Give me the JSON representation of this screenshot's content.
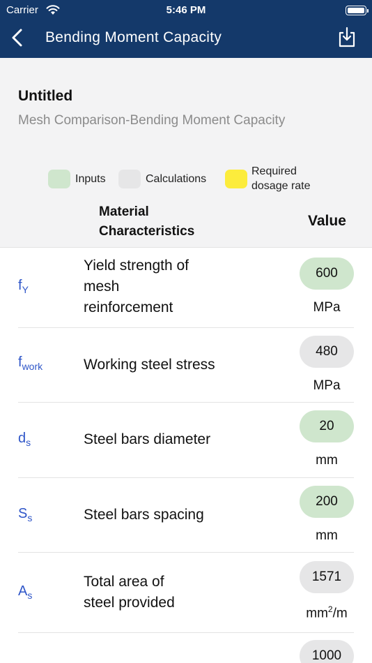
{
  "status_bar": {
    "carrier": "Carrier",
    "time": "5:46 PM"
  },
  "nav": {
    "title": "Bending Moment Capacity",
    "back_icon": "chevron-left-icon",
    "download_icon": "download-icon"
  },
  "document": {
    "title": "Untitled",
    "subtitle": "Mesh Comparison-Bending Moment Capacity"
  },
  "legend": {
    "inputs": "Inputs",
    "calculations": "Calculations",
    "required_line1": "Required",
    "required_line2": "dosage rate",
    "colors": {
      "inputs": "#cfe6cd",
      "calculations": "#e6e6e7",
      "required": "#fcec3c"
    }
  },
  "table": {
    "header_material_line1": "Material",
    "header_material_line2": "Characteristics",
    "header_value": "Value",
    "rows": [
      {
        "sym": "f",
        "sub": "Y",
        "desc_lines": [
          "Yield strength of",
          "mesh",
          "reinforcement"
        ],
        "value": "600",
        "unit": "MPa",
        "kind": "input"
      },
      {
        "sym": "f",
        "sub": "work",
        "desc_lines": [
          "Working steel stress"
        ],
        "value": "480",
        "unit": "MPa",
        "kind": "calc"
      },
      {
        "sym": "d",
        "sub": "s",
        "desc_lines": [
          "Steel bars diameter"
        ],
        "value": "20",
        "unit": "mm",
        "kind": "input"
      },
      {
        "sym": "S",
        "sub": "s",
        "desc_lines": [
          "Steel bars spacing"
        ],
        "value": "200",
        "unit": "mm",
        "kind": "input"
      },
      {
        "sym": "A",
        "sub": "s",
        "desc_lines": [
          "Total area of",
          "steel provided"
        ],
        "value": "1571",
        "unit_base": "mm",
        "unit_sup": "2",
        "unit_rest": "/m",
        "kind": "calc"
      },
      {
        "value": "1000",
        "kind": "calc"
      }
    ]
  }
}
